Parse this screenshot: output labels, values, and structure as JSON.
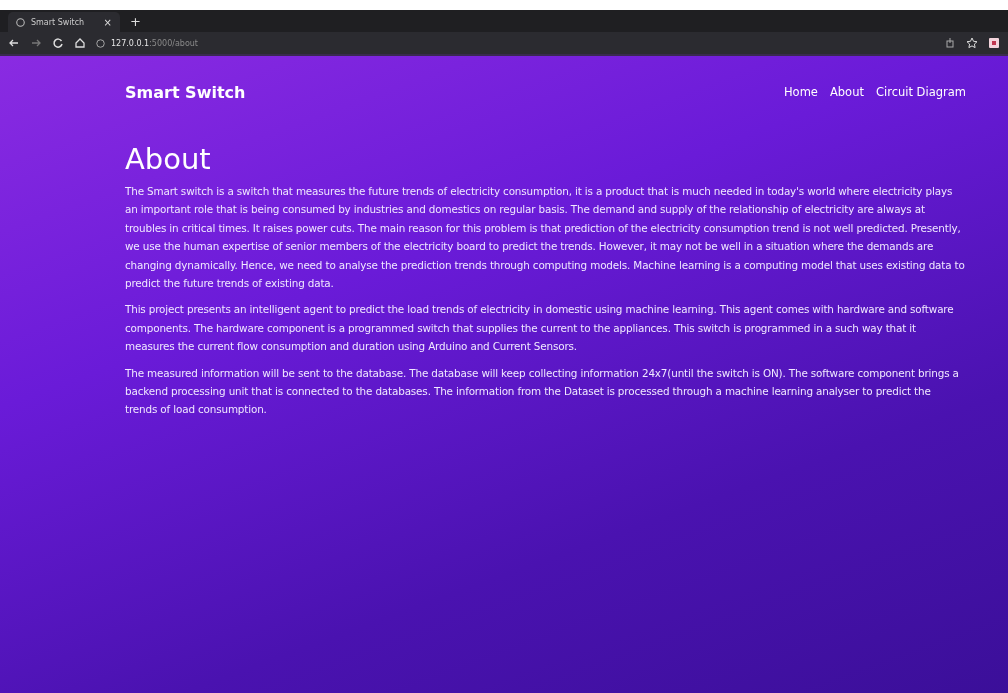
{
  "browser": {
    "tab_title": "Smart Switch",
    "tab_close": "×",
    "new_tab": "+",
    "url_host": "127.0.0.1",
    "url_path": ":5000/about"
  },
  "navbar": {
    "brand": "Smart Switch",
    "links": [
      {
        "label": "Home"
      },
      {
        "label": "About"
      },
      {
        "label": "Circuit Diagram"
      }
    ]
  },
  "heading": "About",
  "paragraphs": [
    "The Smart switch is a switch that measures the future trends of electricity consumption, it is a product that is much needed in today's world where electricity plays an important role that is being consumed by industries and domestics on regular basis. The demand and supply of the relationship of electricity are always at troubles in critical times. It raises power cuts. The main reason for this problem is that prediction of the electricity consumption trend is not well predicted. Presently, we use the human expertise of senior members of the electricity board to predict the trends. However, it may not be well in a situation where the demands are changing dynamically. Hence, we need to analyse the prediction trends through computing models. Machine learning is a computing model that uses existing data to predict the future trends of existing data.",
    "This project presents an intelligent agent to predict the load trends of electricity in domestic using machine learning. This agent comes with hardware and software components. The hardware component is a programmed switch that supplies the current to the appliances. This switch is programmed in a such way that it measures the current flow consumption and duration using Arduino and Current Sensors.",
    "The measured information will be sent to the database. The database will keep collecting information 24x7(until the switch is ON). The software component brings a backend processing unit that is connected to the databases. The information from the Dataset is processed through a machine learning analyser to predict the trends of load consumption."
  ]
}
